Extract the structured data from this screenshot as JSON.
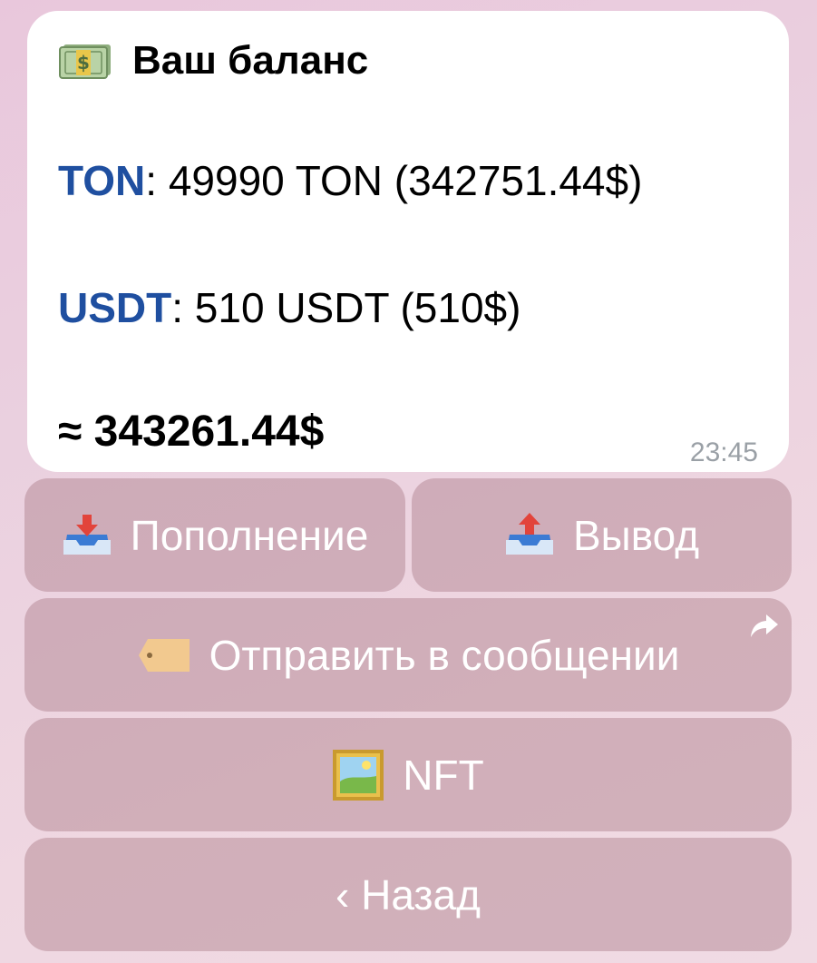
{
  "message": {
    "title": "Ваш баланс",
    "title_icon": "money-banknote-icon",
    "ton": {
      "ticker": "TON",
      "amount": ": 49990 TON (342751.44$)"
    },
    "usdt": {
      "ticker": "USDT",
      "amount": ": 510 USDT (510$)"
    },
    "total": "≈ 343261.44$",
    "time": "23:45"
  },
  "buttons": {
    "deposit": {
      "label": "Пополнение",
      "icon": "inbox-tray-icon"
    },
    "withdraw": {
      "label": "Вывод",
      "icon": "outbox-tray-icon"
    },
    "send": {
      "label": "Отправить в сообщении",
      "icon": "tag-icon"
    },
    "nft": {
      "label": "NFT",
      "icon": "framed-picture-icon"
    },
    "back": {
      "label": "‹ Назад"
    }
  },
  "colors": {
    "ticker": "#1f4fa0",
    "time": "#9aa0a6",
    "button_bg": "#b98c99"
  }
}
